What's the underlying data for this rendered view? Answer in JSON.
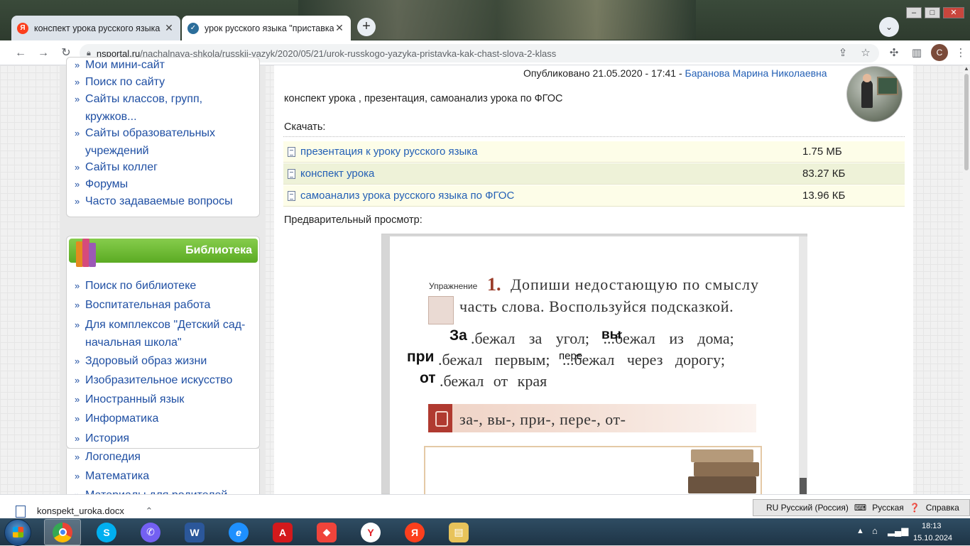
{
  "browser": {
    "tabs": [
      {
        "title": "конспект урока русского языка",
        "icon": "yandex-icon",
        "color": "#fc3f1d"
      },
      {
        "title": "урок русского языка \"приставка",
        "icon": "nsportal-check-icon",
        "color": "#2c6e9b"
      }
    ],
    "url_host": "nsportal.ru",
    "url_path": "/nachalnaya-shkola/russkii-yazyk/2020/05/21/urok-russkogo-yazyka-pristavka-kak-chast-slova-2-klass",
    "profile_initial": "С"
  },
  "sidebar": {
    "menu_items": [
      "Мои мини-сайт",
      "Поиск по сайту",
      "Сайты классов, групп, кружков...",
      "Сайты образовательных учреждений",
      "Сайты коллег",
      "Форумы",
      "Часто задаваемые вопросы"
    ],
    "library_title": "Библиотека",
    "library_items": [
      "Поиск по библиотеке",
      "Воспитательная работа",
      "Для комплексов \"Детский сад-начальная школа\"",
      "Здоровый образ жизни",
      "Изобразительное искусство",
      "Иностранный язык",
      "Информатика",
      "История",
      "Логопедия",
      "Математика",
      "Материалы для родителей"
    ]
  },
  "article": {
    "published": "Опубликовано 21.05.2020 - 17:41 -",
    "author": "Баранова Марина Николаевна",
    "description": "конспект урока , презентация, самоанализ урока по ФГОС",
    "download_label": "Скачать:",
    "files": [
      {
        "name": "презентация к уроку русского языка",
        "size": "1.75 МБ",
        "bg": "#fdfde8"
      },
      {
        "name": "конспект урока",
        "size": "83.27 КБ",
        "bg": "#eef2d8"
      },
      {
        "name": "самоанализ урока русского языка по ФГОС",
        "size": "13.96 КБ",
        "bg": "#fdfde8"
      }
    ],
    "preview_label": "Предварительный просмотр:"
  },
  "exercise": {
    "label": "Упражнение",
    "number": "1.",
    "line1": "Допиши недостающую по смыслу",
    "line2": "часть слова. Воспользуйся подсказкой.",
    "line3": ".бежал за угол; ...бежал из дома;",
    "line4": ".бежал первым; ...бежал через дорогу;",
    "line5": ".бежал от края",
    "hw1": "За",
    "hw2": "вы",
    "hw3": "при",
    "hw4": "пере",
    "hw5": "от",
    "hint": "за-, вы-, при-, пере-, от-"
  },
  "downloads_bar": {
    "file": "konspekt_uroka.docx"
  },
  "language_bar": {
    "lang": "RU Русский (Россия)",
    "layout": "Русская",
    "help": "Справка"
  },
  "taskbar": {
    "time": "18:13",
    "date": "15.10.2024"
  }
}
